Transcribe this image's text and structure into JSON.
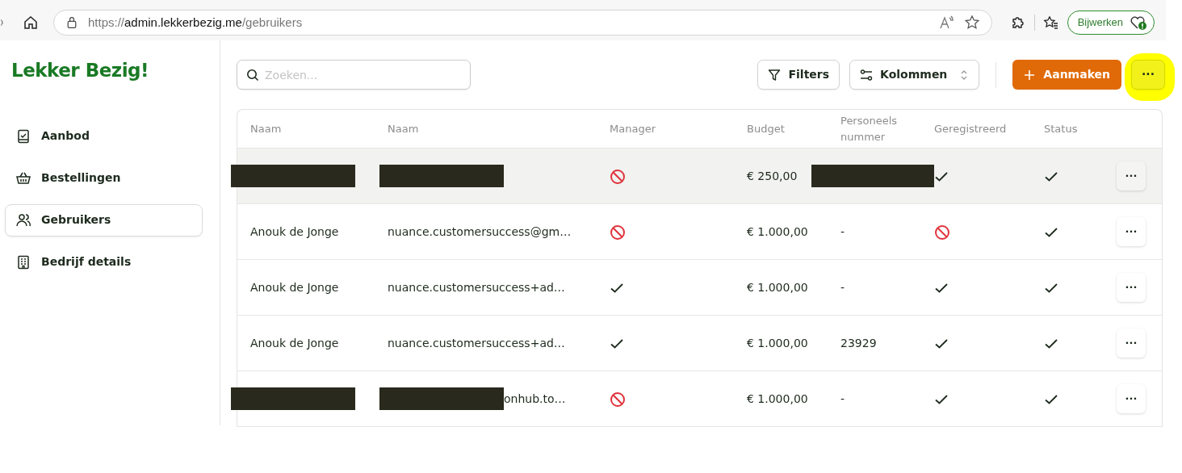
{
  "browser": {
    "url_host": "admin.lekkerbezig.me",
    "url_scheme": "https://",
    "url_path": "/gebruikers",
    "update_button": "Bijwerken"
  },
  "sidebar": {
    "logo": "Lekker Bezig!",
    "items": [
      {
        "label": "Aanbod",
        "selected": false
      },
      {
        "label": "Bestellingen",
        "selected": false
      },
      {
        "label": "Gebruikers",
        "selected": true
      },
      {
        "label": "Bedrijf details",
        "selected": false
      }
    ]
  },
  "toolbar": {
    "search_placeholder": "Zoeken...",
    "filters": "Filters",
    "columns": "Kolommen",
    "create": "Aanmaken",
    "more": "···",
    "more_highlighted": true
  },
  "table": {
    "columns": [
      "Naam",
      "Naam",
      "Manager",
      "Budget",
      "Personeels nummer",
      "Geregistreerd",
      "Status"
    ],
    "rows": [
      {
        "hovered": true,
        "name": {
          "redacted": true
        },
        "email": {
          "redacted": true
        },
        "manager": false,
        "budget": "€ 250,00",
        "number": {
          "redacted": true
        },
        "registered": true,
        "status": true,
        "menu": "···"
      },
      {
        "hovered": false,
        "name": {
          "text": "Anouk de Jonge",
          "redacted": false
        },
        "email": {
          "text": "nuance.customersuccess@gm…",
          "redacted": false
        },
        "manager": false,
        "budget": "€ 1.000,00",
        "number": {
          "text": "-",
          "redacted": false
        },
        "registered": false,
        "status": true,
        "menu": "···"
      },
      {
        "hovered": false,
        "name": {
          "text": "Anouk de Jonge",
          "redacted": false
        },
        "email": {
          "text": "nuance.customersuccess+ad…",
          "redacted": false
        },
        "manager": true,
        "budget": "€ 1.000,00",
        "number": {
          "text": "-",
          "redacted": false
        },
        "registered": true,
        "status": true,
        "menu": "···"
      },
      {
        "hovered": false,
        "name": {
          "text": "Anouk de Jonge",
          "redacted": false
        },
        "email": {
          "text": "nuance.customersuccess+ad…",
          "redacted": false
        },
        "manager": true,
        "budget": "€ 1.000,00",
        "number": {
          "text": "23929",
          "redacted": false
        },
        "registered": true,
        "status": true,
        "menu": "···"
      },
      {
        "hovered": false,
        "name": {
          "redacted": true
        },
        "email": {
          "text": "onhub.to…",
          "redacted": true
        },
        "manager": false,
        "budget": "€ 1.000,00",
        "number": {
          "text": "-",
          "redacted": false
        },
        "registered": true,
        "status": true,
        "menu": "···"
      }
    ]
  }
}
